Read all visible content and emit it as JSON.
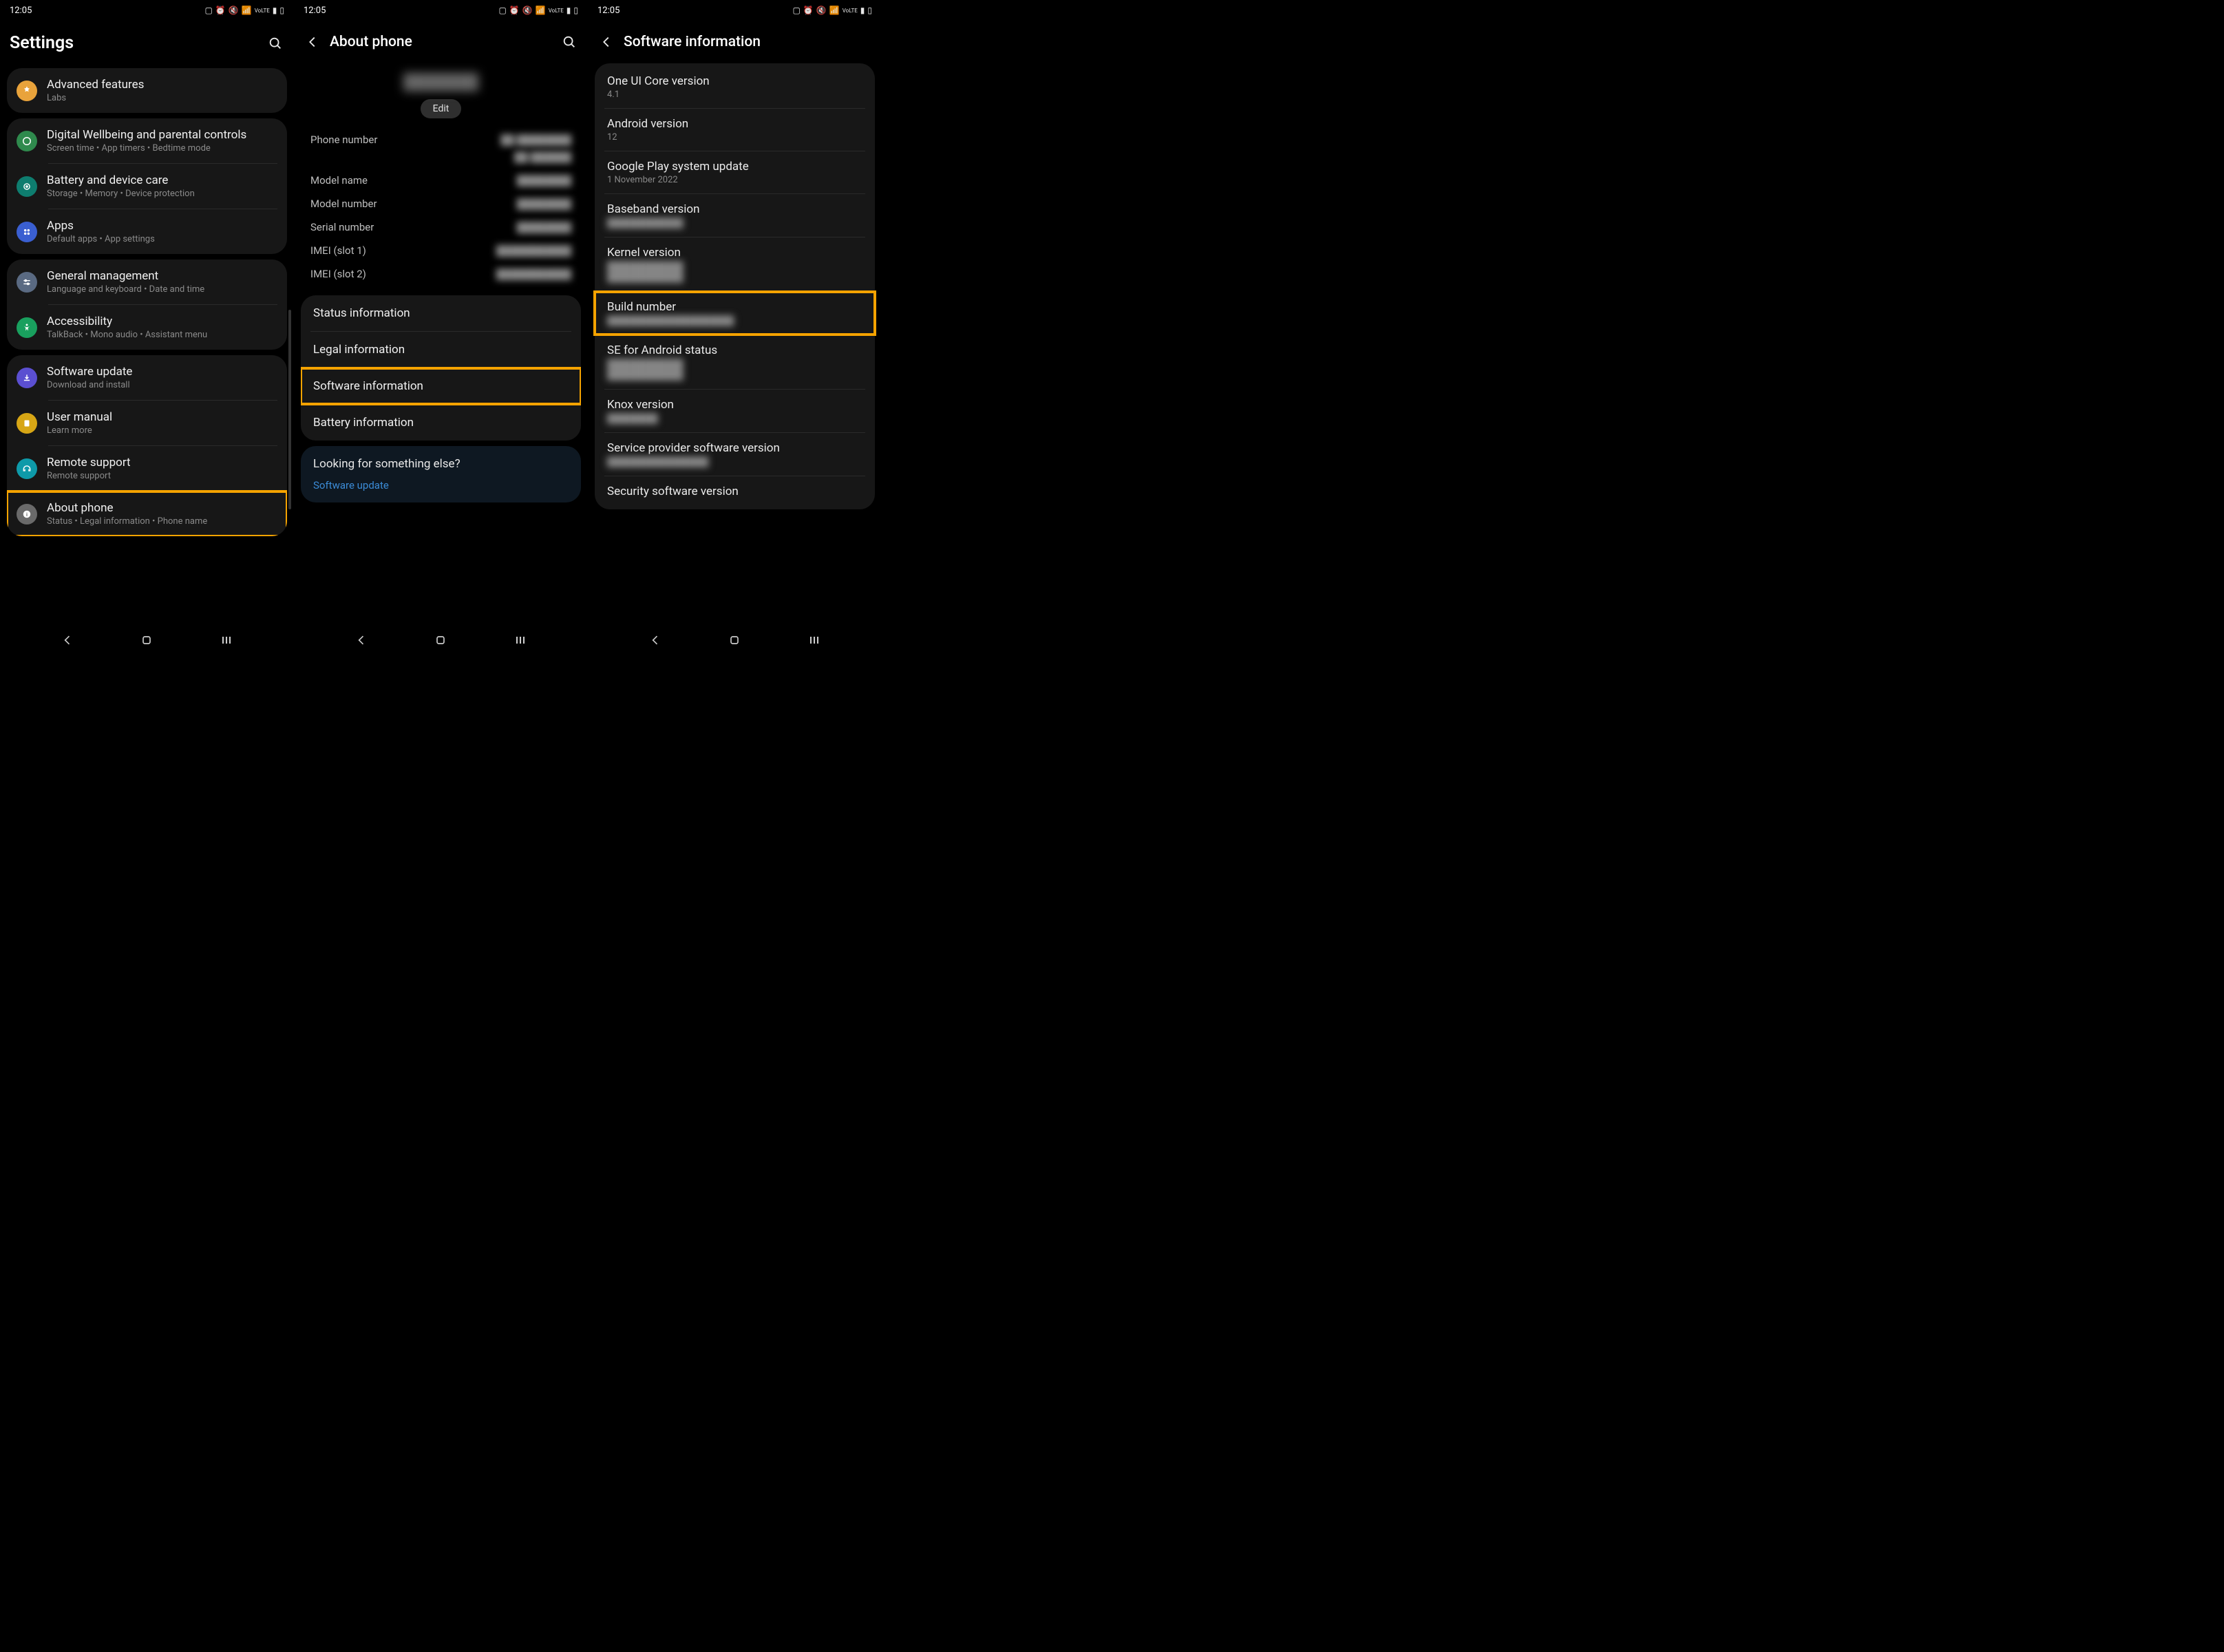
{
  "status": {
    "time": "12:05"
  },
  "screen1": {
    "title": "Settings",
    "groups": [
      {
        "rows": [
          {
            "icon": "advanced",
            "icon_bg": "#e9a33b",
            "title": "Advanced features",
            "sub": "Labs"
          }
        ]
      },
      {
        "rows": [
          {
            "icon": "wellbeing",
            "icon_bg": "#2f8a4d",
            "title": "Digital Wellbeing and parental controls",
            "sub": "Screen time  •  App timers  •  Bedtime mode"
          },
          {
            "icon": "battery",
            "icon_bg": "#0e7d6f",
            "title": "Battery and device care",
            "sub": "Storage  •  Memory  •  Device protection"
          },
          {
            "icon": "apps",
            "icon_bg": "#3a5fd1",
            "title": "Apps",
            "sub": "Default apps  •  App settings"
          }
        ]
      },
      {
        "rows": [
          {
            "icon": "general",
            "icon_bg": "#5a6a82",
            "title": "General management",
            "sub": "Language and keyboard  •  Date and time"
          },
          {
            "icon": "accessibility",
            "icon_bg": "#19a05e",
            "title": "Accessibility",
            "sub": "TalkBack  •  Mono audio  •  Assistant menu"
          }
        ]
      },
      {
        "rows": [
          {
            "icon": "update",
            "icon_bg": "#5b4fd1",
            "title": "Software update",
            "sub": "Download and install"
          },
          {
            "icon": "manual",
            "icon_bg": "#d7a615",
            "title": "User manual",
            "sub": "Learn more"
          },
          {
            "icon": "support",
            "icon_bg": "#0e9aa9",
            "title": "Remote support",
            "sub": "Remote support"
          },
          {
            "icon": "about",
            "icon_bg": "#6a6a6a",
            "title": "About phone",
            "sub": "Status  •  Legal information  •  Phone name",
            "highlight": true
          }
        ]
      }
    ]
  },
  "screen2": {
    "title": "About phone",
    "phone_name_blur": "███████",
    "edit": "Edit",
    "spec_rows": [
      {
        "k": "Phone number",
        "v": "██ ████████"
      },
      {
        "k": "",
        "v": "██ ██████"
      },
      {
        "k": "Model name",
        "v": "████████"
      },
      {
        "k": "Model number",
        "v": "████████"
      },
      {
        "k": "Serial number",
        "v": "████████"
      },
      {
        "k": "IMEI (slot 1)",
        "v": "███████████"
      },
      {
        "k": "IMEI (slot 2)",
        "v": "███████████"
      }
    ],
    "info_rows": [
      {
        "label": "Status information"
      },
      {
        "label": "Legal information"
      },
      {
        "label": "Software information",
        "highlight": true
      },
      {
        "label": "Battery information"
      }
    ],
    "suggest_title": "Looking for something else?",
    "suggest_link": "Software update"
  },
  "screen3": {
    "title": "Software information",
    "items": [
      {
        "label": "One UI Core version",
        "val": "4.1"
      },
      {
        "label": "Android version",
        "val": "12"
      },
      {
        "label": "Google Play system update",
        "val": "1 November 2022"
      },
      {
        "label": "Baseband version",
        "val": "████████████",
        "blur": true
      },
      {
        "label": "Kernel version",
        "val": "████████████\n████████████",
        "blur": true
      },
      {
        "label": "Build number",
        "val": "████████████████████",
        "blur": true,
        "highlight": true
      },
      {
        "label": "SE for Android status",
        "val": "████████████\n████████████",
        "blur": true
      },
      {
        "label": "Knox version",
        "val": "████████",
        "blur": true
      },
      {
        "label": "Service provider software version",
        "val": "████████████████",
        "blur": true
      },
      {
        "label": "Security software version",
        "val": ""
      }
    ]
  }
}
